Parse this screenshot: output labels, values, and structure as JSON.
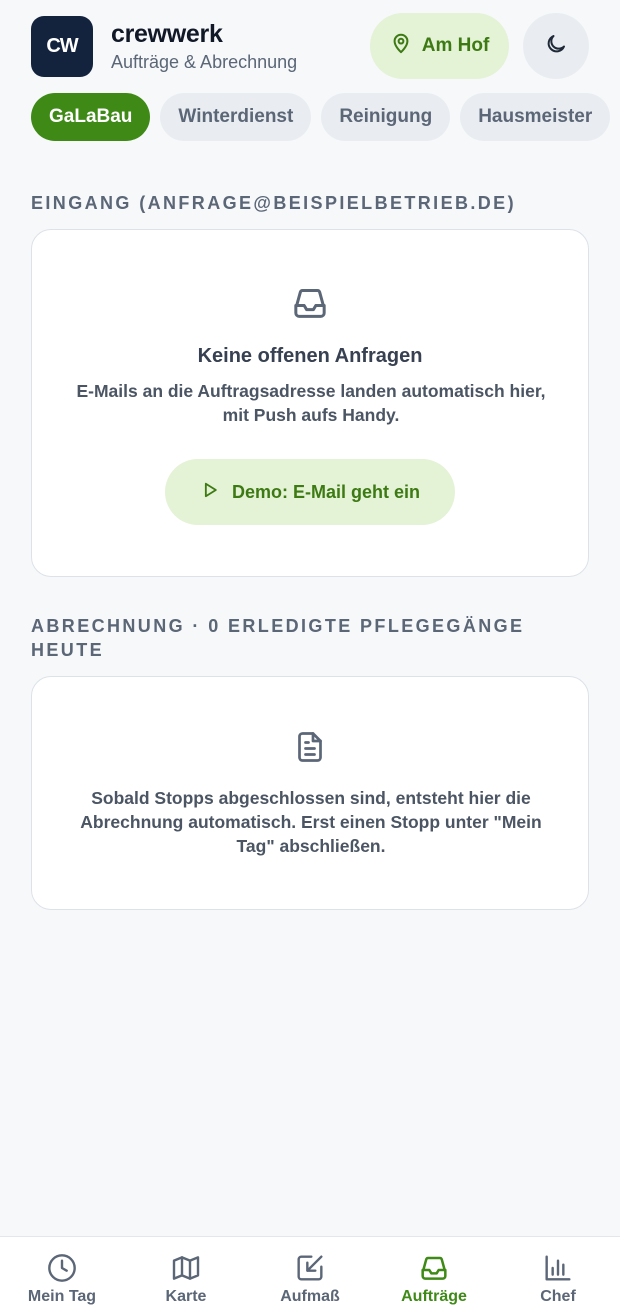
{
  "header": {
    "logo_text": "CW",
    "app_name": "crewwerk",
    "subtitle": "Aufträge & Abrechnung",
    "status_pill": {
      "label": "Am Hof",
      "icon": "map-pin-icon"
    },
    "theme_toggle": {
      "icon": "moon-icon"
    }
  },
  "tabs": [
    {
      "label": "GaLaBau",
      "active": true
    },
    {
      "label": "Winterdienst",
      "active": false
    },
    {
      "label": "Reinigung",
      "active": false
    },
    {
      "label": "Hausmeister",
      "active": false
    }
  ],
  "inbox": {
    "section_title": "Eingang (anfrage@beispielbetrieb.de)",
    "icon": "inbox-icon",
    "empty_title": "Keine offenen Anfragen",
    "empty_text": "E-Mails an die Auftragsadresse landen automatisch hier, mit Push aufs Handy.",
    "demo_button": {
      "label": "Demo: E-Mail geht ein",
      "icon": "play-icon"
    }
  },
  "billing": {
    "section_title": "Abrechnung · 0 erledigte Pflegegänge heute",
    "icon": "document-icon",
    "empty_text": "Sobald Stopps abgeschlossen sind, entsteht hier die Abrechnung automatisch. Erst einen Stopp unter \"Mein Tag\" abschließen."
  },
  "bottom_nav": [
    {
      "label": "Mein Tag",
      "icon": "clock-icon",
      "active": false
    },
    {
      "label": "Karte",
      "icon": "map-icon",
      "active": false
    },
    {
      "label": "Aufmaß",
      "icon": "measure-icon",
      "active": false
    },
    {
      "label": "Aufträge",
      "icon": "inbox-icon",
      "active": true
    },
    {
      "label": "Chef",
      "icon": "bar-chart-icon",
      "active": false
    }
  ],
  "colors": {
    "accent": "#3f8a17",
    "accent_soft": "#e4f2d6",
    "logo_bg": "#13233d",
    "background": "#f6f8fa"
  }
}
